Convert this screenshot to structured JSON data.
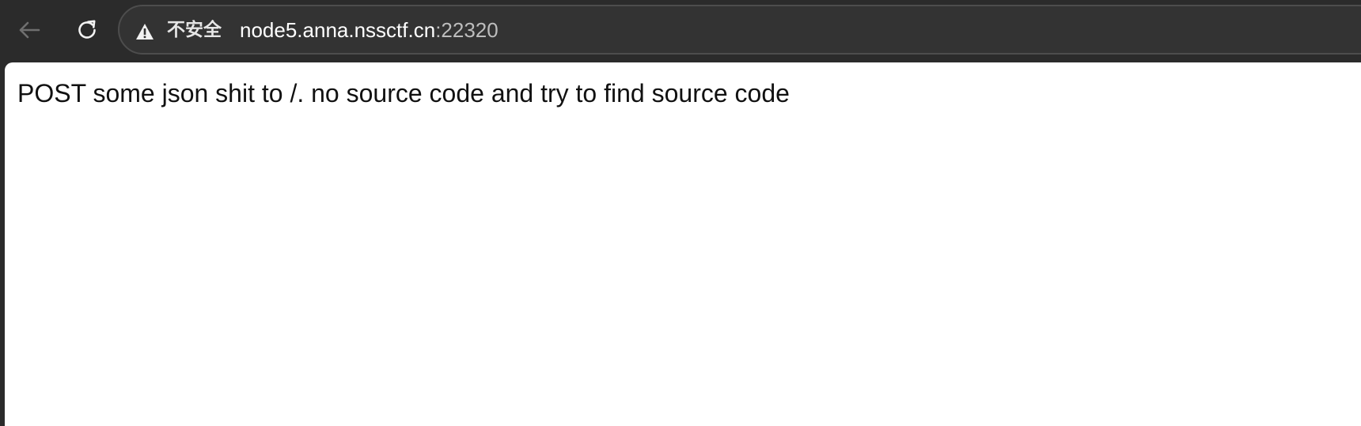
{
  "toolbar": {
    "back_icon": "arrow-left-icon",
    "reload_icon": "reload-icon"
  },
  "address_bar": {
    "security_icon": "warning-icon",
    "security_label": "不安全",
    "url_host": "node5.anna.nssctf.cn",
    "url_port": ":22320"
  },
  "page": {
    "message": "POST some json shit to /. no source code and try to find source code"
  }
}
